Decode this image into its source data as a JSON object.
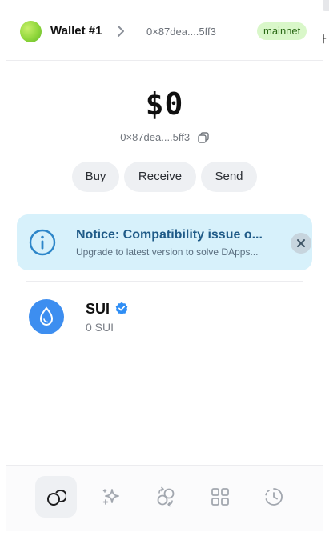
{
  "header": {
    "wallet_name": "Wallet #1",
    "address": "0×87dea....5ff3",
    "network": "mainnet"
  },
  "balance": {
    "amount": "$0",
    "address": "0×87dea....5ff3"
  },
  "actions": {
    "buy": "Buy",
    "receive": "Receive",
    "send": "Send"
  },
  "notice": {
    "title": "Notice: Compatibility issue o...",
    "text": "Upgrade to latest version to solve DApps..."
  },
  "tokens": [
    {
      "name": "SUI",
      "amount": "0 SUI"
    }
  ],
  "nav": {
    "items": [
      "home-icon",
      "sparkle-icon",
      "swap-icon",
      "apps-grid-icon",
      "history-icon"
    ],
    "active": 0
  },
  "colors": {
    "accent": "#3d8ef0",
    "notice_bg": "#d7f1fb",
    "badge_bg": "#d9f7c9",
    "badge_text": "#2b6a16"
  }
}
